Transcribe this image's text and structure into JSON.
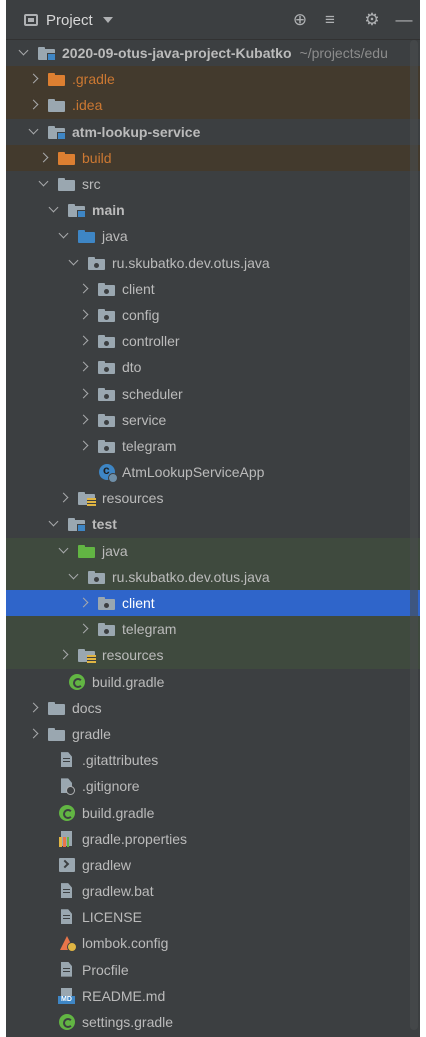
{
  "toolbar": {
    "title": "Project",
    "icons": [
      "project-view-icon",
      "chevron-down-icon",
      "locate-icon",
      "collapse-all-icon",
      "gear-icon",
      "hide-icon"
    ]
  },
  "tree": [
    {
      "depth": 0,
      "arrow": "d",
      "icon": "module-folder",
      "label": "2020-09-otus-java-project-Kubatko",
      "suffix": "~/projects/edu",
      "bold": true,
      "state": ""
    },
    {
      "depth": 1,
      "arrow": "r",
      "icon": "folder-orange",
      "label": ".gradle",
      "state": "excl"
    },
    {
      "depth": 1,
      "arrow": "r",
      "icon": "folder-gray",
      "label": ".idea",
      "state": "excl"
    },
    {
      "depth": 1,
      "arrow": "d",
      "icon": "module-folder",
      "label": "atm-lookup-service",
      "bold": true,
      "state": ""
    },
    {
      "depth": 2,
      "arrow": "r",
      "icon": "folder-orange",
      "label": "build",
      "state": "excl"
    },
    {
      "depth": 2,
      "arrow": "d",
      "icon": "folder-gray",
      "label": "src",
      "state": ""
    },
    {
      "depth": 3,
      "arrow": "d",
      "icon": "module-folder",
      "label": "main",
      "bold": true,
      "state": ""
    },
    {
      "depth": 4,
      "arrow": "d",
      "icon": "folder-blue",
      "label": "java",
      "state": ""
    },
    {
      "depth": 5,
      "arrow": "d",
      "icon": "package",
      "label": "ru.skubatko.dev.otus.java",
      "state": ""
    },
    {
      "depth": 6,
      "arrow": "r",
      "icon": "package",
      "label": "client",
      "state": ""
    },
    {
      "depth": 6,
      "arrow": "r",
      "icon": "package",
      "label": "config",
      "state": ""
    },
    {
      "depth": 6,
      "arrow": "r",
      "icon": "package",
      "label": "controller",
      "state": ""
    },
    {
      "depth": 6,
      "arrow": "r",
      "icon": "package",
      "label": "dto",
      "state": ""
    },
    {
      "depth": 6,
      "arrow": "r",
      "icon": "package",
      "label": "scheduler",
      "state": ""
    },
    {
      "depth": 6,
      "arrow": "r",
      "icon": "package",
      "label": "service",
      "state": ""
    },
    {
      "depth": 6,
      "arrow": "r",
      "icon": "package",
      "label": "telegram",
      "state": ""
    },
    {
      "depth": 6,
      "arrow": "n",
      "icon": "class-app",
      "label": "AtmLookupServiceApp",
      "state": ""
    },
    {
      "depth": 4,
      "arrow": "r",
      "icon": "resources",
      "label": "resources",
      "state": ""
    },
    {
      "depth": 3,
      "arrow": "d",
      "icon": "module-folder",
      "label": "test",
      "bold": true,
      "state": ""
    },
    {
      "depth": 4,
      "arrow": "d",
      "icon": "folder-green",
      "label": "java",
      "state": "hl"
    },
    {
      "depth": 5,
      "arrow": "d",
      "icon": "package",
      "label": "ru.skubatko.dev.otus.java",
      "state": "hl"
    },
    {
      "depth": 6,
      "arrow": "r",
      "icon": "package",
      "label": "client",
      "state": "sel"
    },
    {
      "depth": 6,
      "arrow": "r",
      "icon": "package",
      "label": "telegram",
      "state": "hl"
    },
    {
      "depth": 4,
      "arrow": "r",
      "icon": "resources-test",
      "label": "resources",
      "state": "hl"
    },
    {
      "depth": 3,
      "arrow": "n",
      "icon": "gradle",
      "label": "build.gradle",
      "state": ""
    },
    {
      "depth": 1,
      "arrow": "r",
      "icon": "folder-gray",
      "label": "docs",
      "state": ""
    },
    {
      "depth": 1,
      "arrow": "r",
      "icon": "folder-gray",
      "label": "gradle",
      "state": ""
    },
    {
      "depth": 2,
      "arrow": "n",
      "icon": "text-file",
      "label": ".gitattributes",
      "state": ""
    },
    {
      "depth": 2,
      "arrow": "n",
      "icon": "gitignore-file",
      "label": ".gitignore",
      "state": ""
    },
    {
      "depth": 2,
      "arrow": "n",
      "icon": "gradle",
      "label": "build.gradle",
      "state": ""
    },
    {
      "depth": 2,
      "arrow": "n",
      "icon": "properties-file",
      "label": "gradle.properties",
      "state": ""
    },
    {
      "depth": 2,
      "arrow": "n",
      "icon": "shell-script",
      "label": "gradlew",
      "state": ""
    },
    {
      "depth": 2,
      "arrow": "n",
      "icon": "text-file",
      "label": "gradlew.bat",
      "state": ""
    },
    {
      "depth": 2,
      "arrow": "n",
      "icon": "text-file",
      "label": "LICENSE",
      "state": ""
    },
    {
      "depth": 2,
      "arrow": "n",
      "icon": "lombok-config",
      "label": "lombok.config",
      "state": ""
    },
    {
      "depth": 2,
      "arrow": "n",
      "icon": "text-file",
      "label": "Procfile",
      "state": ""
    },
    {
      "depth": 2,
      "arrow": "n",
      "icon": "markdown-file",
      "label": "README.md",
      "state": ""
    },
    {
      "depth": 2,
      "arrow": "n",
      "icon": "gradle",
      "label": "settings.gradle",
      "state": ""
    }
  ]
}
